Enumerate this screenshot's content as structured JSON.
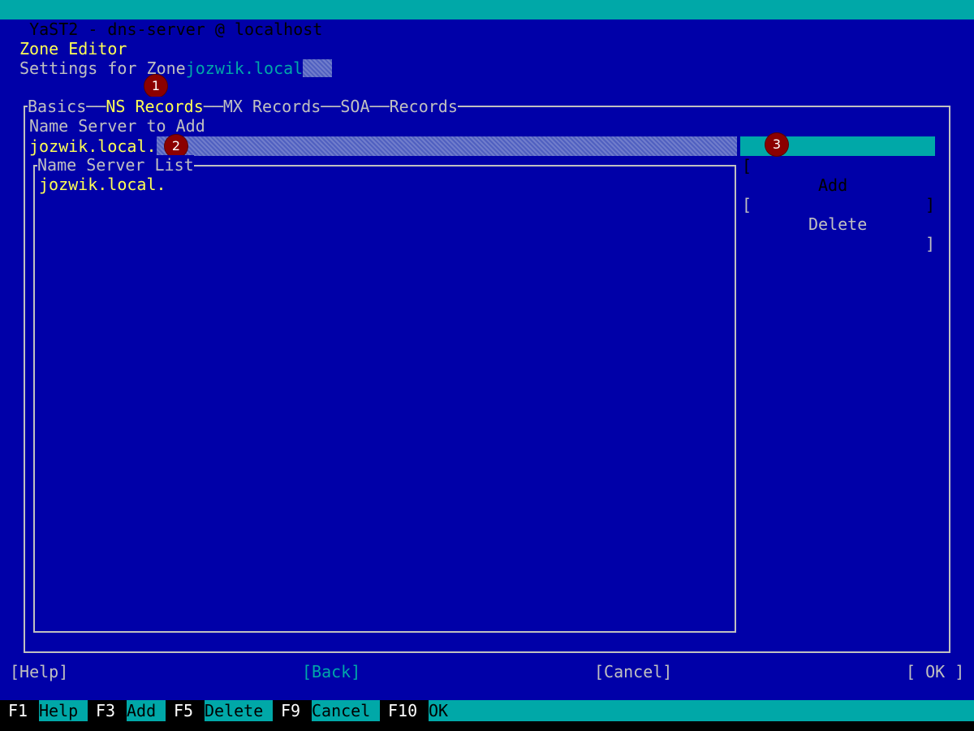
{
  "window": {
    "title": "YaST2 - dns-server @ localhost"
  },
  "header": {
    "title": "Zone Editor",
    "subtitle_prefix": "Settings for Zone",
    "zone_name": "jozwik.local"
  },
  "tabs": [
    {
      "label": "Basics",
      "active": false
    },
    {
      "label": "NS Records",
      "active": true
    },
    {
      "label": "MX Records",
      "active": false
    },
    {
      "label": "SOA",
      "active": false
    },
    {
      "label": "Records",
      "active": false
    }
  ],
  "ns_form": {
    "field_label": "Name Server to Add",
    "field_value": "jozwik.local.",
    "add_button": "Add",
    "delete_button": "Delete",
    "list_title": "Name Server List",
    "list_items": [
      "jozwik.local."
    ]
  },
  "markers": [
    "1",
    "2",
    "3"
  ],
  "footer_buttons": {
    "help": "[Help]",
    "back": "[Back]",
    "cancel": "[Cancel]",
    "ok": "[ OK ]"
  },
  "fkeys": [
    {
      "key": "F1",
      "label": "Help"
    },
    {
      "key": "F3",
      "label": "Add"
    },
    {
      "key": "F5",
      "label": "Delete"
    },
    {
      "key": "F9",
      "label": "Cancel"
    },
    {
      "key": "F10",
      "label": "OK"
    }
  ],
  "colors": {
    "background": "#0000a8",
    "accent": "#00a8a8",
    "highlight": "#ffff54",
    "marker": "#8b0000"
  }
}
